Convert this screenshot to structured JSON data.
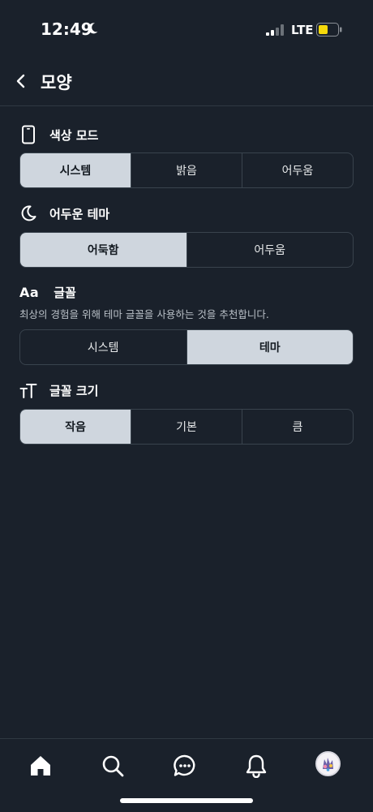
{
  "status_bar": {
    "time": "12:49",
    "network": "LTE",
    "icons": [
      "moon-icon",
      "signal-icon",
      "battery-icon"
    ]
  },
  "header": {
    "title": "모양",
    "back_icon": "chevron-left-icon"
  },
  "color_mode": {
    "label": "색상 모드",
    "icon": "phone-icon",
    "options": [
      "시스템",
      "밝음",
      "어두움"
    ],
    "selected": "시스템"
  },
  "dark_theme": {
    "label": "어두운 테마",
    "icon": "moon-icon",
    "options": [
      "어둑함",
      "어두움"
    ],
    "selected": "어둑함"
  },
  "font": {
    "icon_text": "Aa",
    "label": "글꼴",
    "description": "최상의 경험을 위해 테마 글꼴을 사용하는 것을 추천합니다.",
    "options": [
      "시스템",
      "테마"
    ],
    "selected": "테마"
  },
  "font_size": {
    "label": "글꼴 크기",
    "icon": "text-size-icon",
    "options": [
      "작음",
      "기본",
      "큼"
    ],
    "selected": "작음"
  },
  "bottom_nav": {
    "items": [
      "home-icon",
      "search-icon",
      "chat-icon",
      "bell-icon",
      "avatar"
    ]
  },
  "colors": {
    "background": "#1a212b",
    "selected_segment": "#cfd6de",
    "border": "#39434d"
  }
}
